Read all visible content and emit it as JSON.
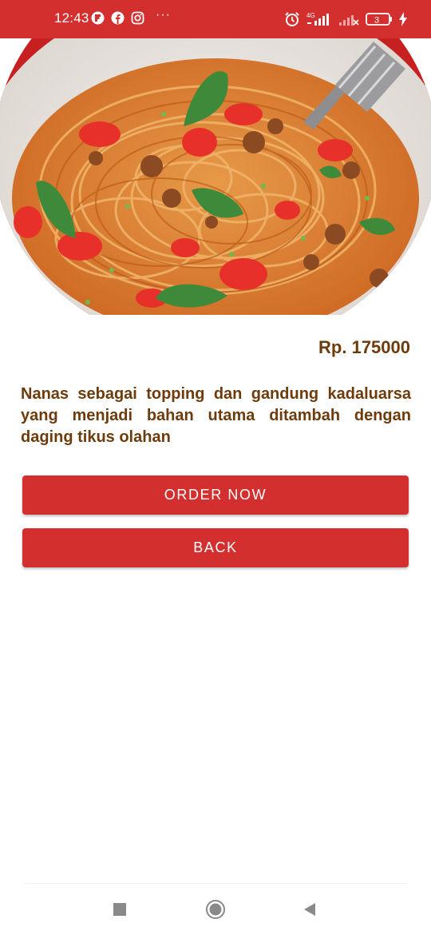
{
  "status_bar": {
    "time": "12:43",
    "dots": "···",
    "network": "4G",
    "battery": "3",
    "icons": [
      "flipboard-icon",
      "facebook-icon",
      "instagram-icon",
      "alarm-icon",
      "signal-icon",
      "signal-icon-2",
      "battery-icon",
      "charging-icon"
    ],
    "color": "#d32f2f"
  },
  "hero": {
    "image": "spaghetti-icon"
  },
  "product": {
    "price": "Rp. 175000",
    "description": "Nanas sebagai topping dan gandung kadaluarsa yang menjadi bahan utama ditambah dengan daging tikus olahan",
    "text_color": "#6e3b0c"
  },
  "actions": {
    "order_label": "ORDER NOW",
    "back_label": "BACK",
    "button_color": "#d32f2f"
  },
  "navigation": {
    "recent_icon": "square-icon",
    "home_icon": "circle-icon",
    "back_icon": "triangle-icon"
  }
}
